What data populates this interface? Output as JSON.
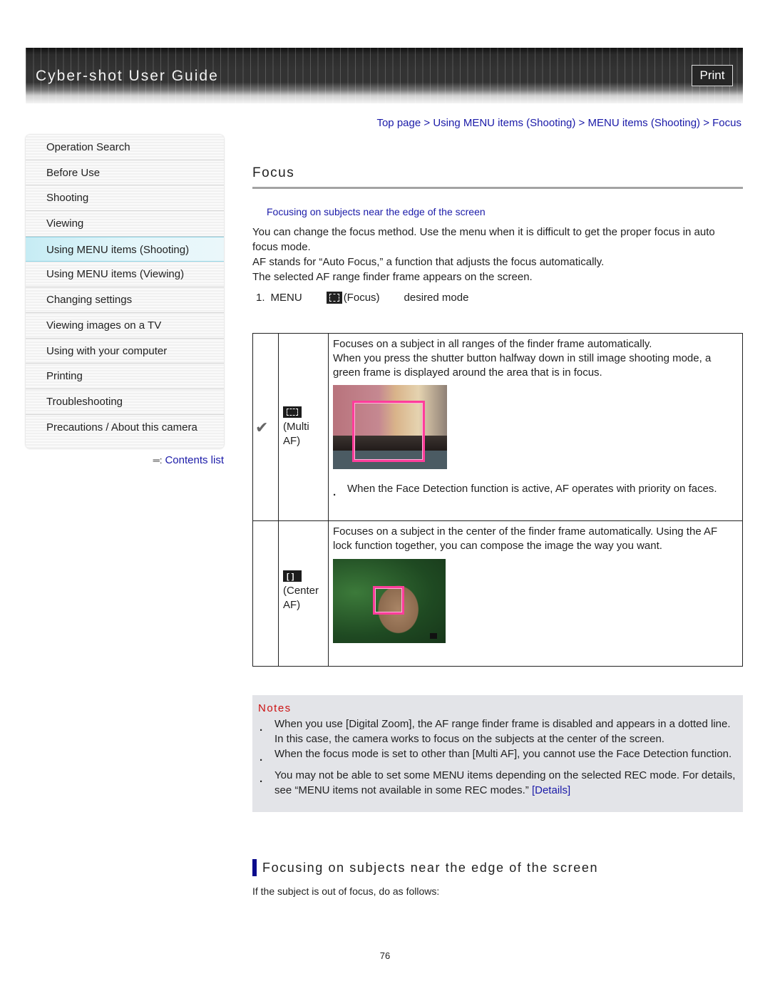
{
  "header": {
    "title": "Cyber-shot User Guide",
    "print_label": "Print"
  },
  "sidebar": {
    "items": [
      {
        "label": "Operation Search",
        "active": false
      },
      {
        "label": "Before Use",
        "active": false
      },
      {
        "label": "Shooting",
        "active": false
      },
      {
        "label": "Viewing",
        "active": false
      },
      {
        "label": "Using MENU items (Shooting)",
        "active": true
      },
      {
        "label": "Using MENU items (Viewing)",
        "active": false
      },
      {
        "label": "Changing settings",
        "active": false
      },
      {
        "label": "Viewing images on a TV",
        "active": false
      },
      {
        "label": "Using with your computer",
        "active": false
      },
      {
        "label": "Printing",
        "active": false
      },
      {
        "label": "Troubleshooting",
        "active": false
      },
      {
        "label": "Precautions / About this camera",
        "active": false
      }
    ],
    "contents_list_label": "Contents list",
    "contents_list_icon": "list-icon"
  },
  "breadcrumb": {
    "items": [
      "Top page",
      "Using MENU items (Shooting)",
      "MENU items (Shooting)",
      "Focus"
    ],
    "separator": " > "
  },
  "main": {
    "title": "Focus",
    "anchor_link": "Focusing on subjects near the edge of the screen",
    "intro": [
      "You can change the focus method. Use the menu when it is difficult to get the proper focus in auto focus mode.",
      "AF stands for “Auto Focus,” a function that adjusts the focus automatically.",
      "The selected AF range finder frame appears on the screen."
    ],
    "step": {
      "number": "1.",
      "menu": "MENU",
      "icon": "focus-icon",
      "focus_label": "(Focus)",
      "desired": "desired mode"
    },
    "modes": [
      {
        "icon": "multi-af-icon",
        "default_icon": "checkmark-icon",
        "label_line1": "(Multi",
        "label_line2": "AF)",
        "description": [
          "Focuses on a subject in all ranges of the finder frame automatically.",
          "When you press the shutter button halfway down in still image shooting mode, a green frame is displayed around the area that is in focus."
        ],
        "note": "When the Face Detection function is active, AF operates with priority on faces."
      },
      {
        "icon": "center-af-icon",
        "label_line1": "(Center",
        "label_line2": "AF)",
        "description": [
          "Focuses on a subject in the center of the finder frame automatically. Using the AF lock function together, you can compose the image the way you want."
        ]
      }
    ]
  },
  "notes": {
    "title": "Notes",
    "items": [
      "When you use [Digital Zoom], the AF range finder frame is disabled and appears in a dotted line. In this case, the camera works to focus on the subjects at the center of the screen.",
      "When the focus mode is set to other than [Multi AF], you cannot use the Face Detection function.",
      "You may not be able to set some MENU items depending on the selected REC mode. For details, see “MENU items not available in some REC modes.”"
    ],
    "details_link": "[Details]"
  },
  "section": {
    "heading": "Focusing on subjects near the edge of the screen",
    "body": "If the subject is out of focus, do as follows:"
  },
  "page_number": "76",
  "colors": {
    "link": "#1a1aa8",
    "notes_title": "#cc1111",
    "section_bar": "#0b0b8c",
    "af_frame": "#ff3d9a"
  }
}
